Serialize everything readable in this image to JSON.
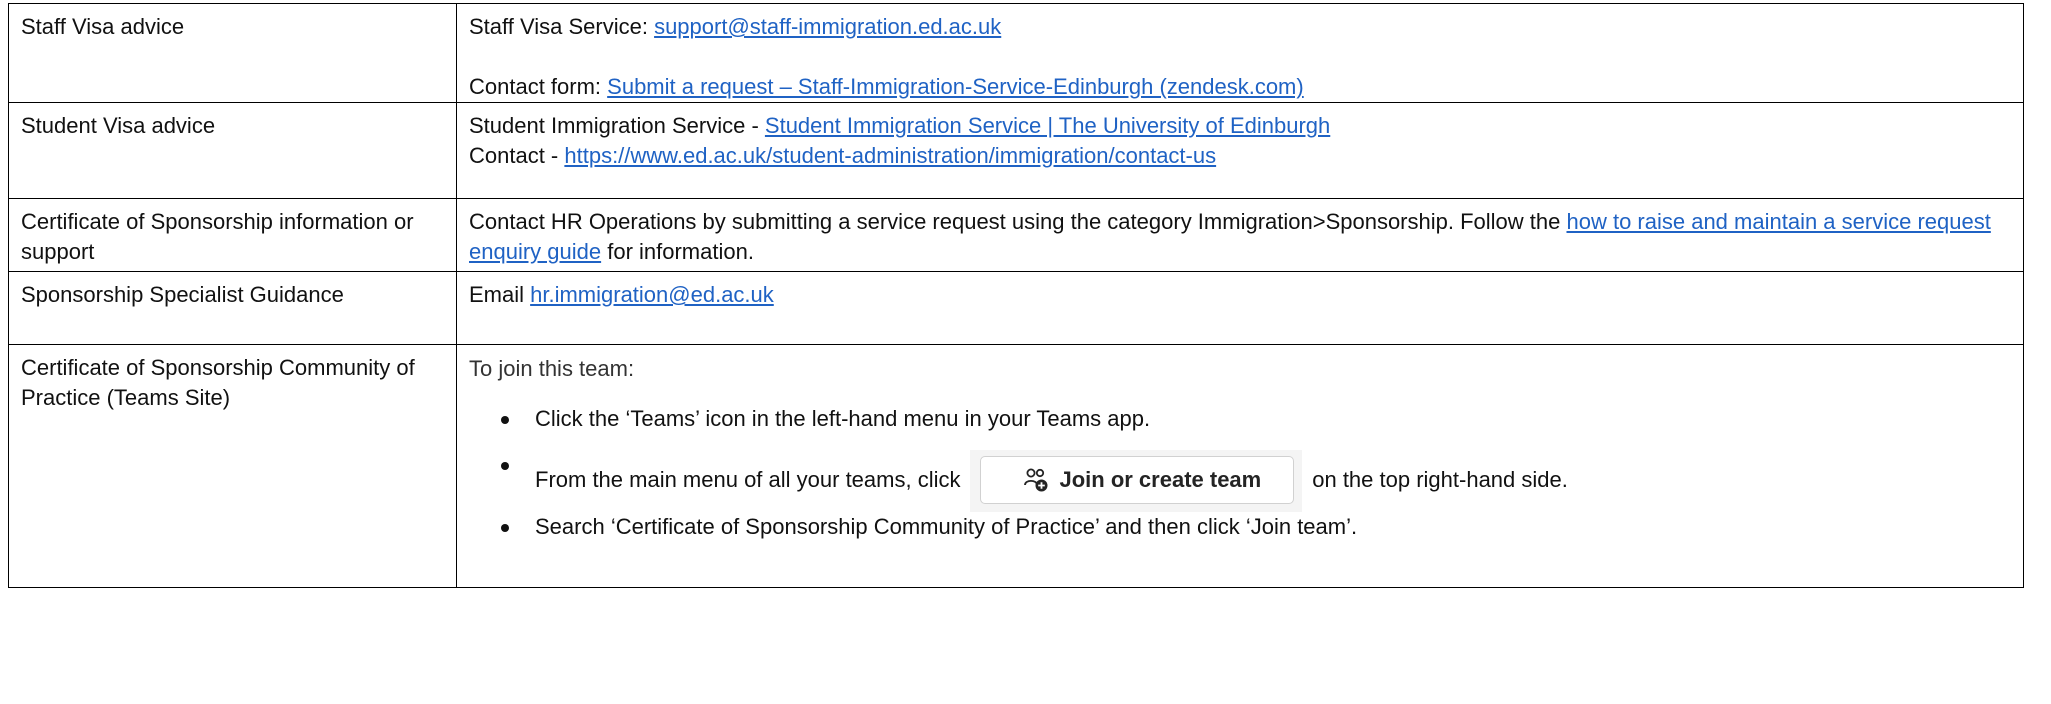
{
  "rows": [
    {
      "label": "Staff Visa advice",
      "line1_prefix": "Staff Visa Service: ",
      "line1_link": "support@staff-immigration.ed.ac.uk",
      "line2_prefix": "Contact form: ",
      "line2_link": "Submit a request – Staff-Immigration-Service-Edinburgh (zendesk.com)"
    },
    {
      "label": "Student Visa advice",
      "line1_prefix": "Student Immigration Service  - ",
      "line1_link": "Student Immigration Service | The University of Edinburgh",
      "line2_prefix": "Contact  - ",
      "line2_link": "https://www.ed.ac.uk/student-administration/immigration/contact-us"
    },
    {
      "label": "Certificate of Sponsorship information or support",
      "text1": "Contact HR Operations by submitting a service request using the category Immigration>Sponsorship. Follow the ",
      "link": "how to raise and maintain a service request enquiry guide",
      "text2": " for information."
    },
    {
      "label": "Sponsorship Specialist Guidance",
      "prefix": "Email ",
      "link": "hr.immigration@ed.ac.uk"
    },
    {
      "label": "Certificate of Sponsorship Community of Practice (Teams Site)",
      "intro": "To join this team:",
      "bullet1": "Click the ‘Teams’ icon in the left-hand menu in your Teams app.",
      "bullet2_before": "From the main menu of all your teams, click",
      "button_label": "Join or create team",
      "button_icon": "people-add-icon",
      "bullet2_after": "on the top right-hand side.",
      "bullet3": "Search ‘Certificate of Sponsorship Community of Practice’ and then click ‘Join team’."
    }
  ]
}
